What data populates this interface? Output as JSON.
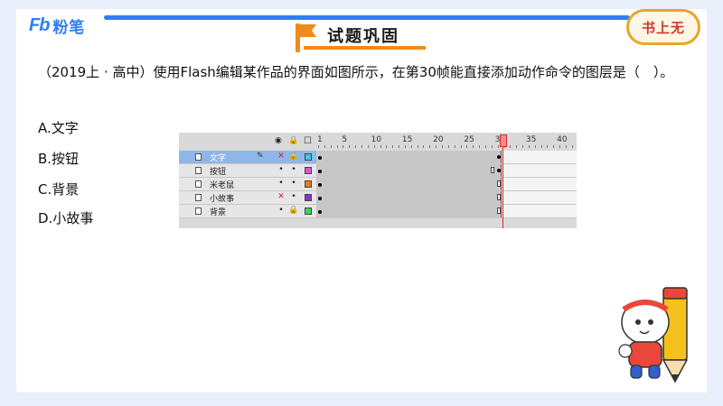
{
  "header": {
    "logo_mark": "Fb",
    "logo_text": "粉笔",
    "section_title": "试题巩固",
    "badge": "书上无"
  },
  "question": {
    "text": "（2019上 · 高中）使用Flash编辑某作品的界面如图所示，在第30帧能直接添加动作命令的图层是（　）。",
    "options": [
      "A.文字",
      "B.按钮",
      "C.背景",
      "D.小故事"
    ]
  },
  "timeline": {
    "ruler_labels": [
      "1",
      "5",
      "10",
      "15",
      "20",
      "25",
      "30",
      "35",
      "40"
    ],
    "current_frame": 30,
    "layers": [
      {
        "name": "文字",
        "selected": true,
        "eye": "✕",
        "lock": "🔒",
        "color": "#3ec7e8",
        "pencil": true,
        "end": "keyframe"
      },
      {
        "name": "按钮",
        "selected": false,
        "eye": "•",
        "lock": "•",
        "color": "#e64fd3",
        "pencil": false,
        "end": "blank-then-keyframe"
      },
      {
        "name": "米老鼠",
        "selected": false,
        "eye": "•",
        "lock": "•",
        "color": "#f07a17",
        "pencil": false,
        "end": "frame"
      },
      {
        "name": "小故事",
        "selected": false,
        "eye": "✕",
        "lock": "•",
        "color": "#8a2fd0",
        "pencil": false,
        "end": "frame"
      },
      {
        "name": "背景",
        "selected": false,
        "eye": "•",
        "lock": "🔒",
        "color": "#3ad65a",
        "pencil": false,
        "end": "frame"
      }
    ]
  },
  "colors": {
    "brand_blue": "#2f7df6",
    "accent_orange": "#f08a1e",
    "badge_red": "#d23b2a",
    "page_bg": "#e9eefb"
  }
}
